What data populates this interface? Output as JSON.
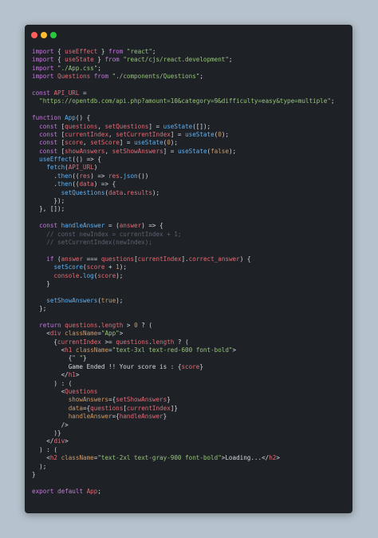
{
  "window": {
    "buttons": [
      "close",
      "minimize",
      "maximize"
    ]
  },
  "code": {
    "lines": [
      [
        [
          "kw",
          "import"
        ],
        [
          "pl",
          " { "
        ],
        [
          "var",
          "useEffect"
        ],
        [
          "pl",
          " } "
        ],
        [
          "kw",
          "from"
        ],
        [
          "pl",
          " "
        ],
        [
          "str",
          "\"react\""
        ],
        [
          "pl",
          ";"
        ]
      ],
      [
        [
          "kw",
          "import"
        ],
        [
          "pl",
          " { "
        ],
        [
          "var",
          "useState"
        ],
        [
          "pl",
          " } "
        ],
        [
          "kw",
          "from"
        ],
        [
          "pl",
          " "
        ],
        [
          "str",
          "\"react/cjs/react.development\""
        ],
        [
          "pl",
          ";"
        ]
      ],
      [
        [
          "kw",
          "import"
        ],
        [
          "pl",
          " "
        ],
        [
          "str",
          "\"./App.css\""
        ],
        [
          "pl",
          ";"
        ]
      ],
      [
        [
          "kw",
          "import"
        ],
        [
          "pl",
          " "
        ],
        [
          "var",
          "Questions"
        ],
        [
          "pl",
          " "
        ],
        [
          "kw",
          "from"
        ],
        [
          "pl",
          " "
        ],
        [
          "str",
          "\"./components/Questions\""
        ],
        [
          "pl",
          ";"
        ]
      ],
      [],
      [
        [
          "kw",
          "const"
        ],
        [
          "pl",
          " "
        ],
        [
          "var",
          "API_URL"
        ],
        [
          "pl",
          " ="
        ]
      ],
      [
        [
          "pl",
          "  "
        ],
        [
          "str",
          "\"https://opentdb.com/api.php?amount=10&category=9&difficulty=easy&type=multiple\""
        ],
        [
          "pl",
          ";"
        ]
      ],
      [],
      [
        [
          "kw",
          "function"
        ],
        [
          "pl",
          " "
        ],
        [
          "fn",
          "App"
        ],
        [
          "pl",
          "() {"
        ]
      ],
      [
        [
          "pl",
          "  "
        ],
        [
          "kw",
          "const"
        ],
        [
          "pl",
          " ["
        ],
        [
          "var",
          "questions"
        ],
        [
          "pl",
          ", "
        ],
        [
          "var",
          "setQuestions"
        ],
        [
          "pl",
          "] = "
        ],
        [
          "fn",
          "useState"
        ],
        [
          "pl",
          "([]);"
        ]
      ],
      [
        [
          "pl",
          "  "
        ],
        [
          "kw",
          "const"
        ],
        [
          "pl",
          " ["
        ],
        [
          "var",
          "currentIndex"
        ],
        [
          "pl",
          ", "
        ],
        [
          "var",
          "setCurrentIndex"
        ],
        [
          "pl",
          "] = "
        ],
        [
          "fn",
          "useState"
        ],
        [
          "pl",
          "("
        ],
        [
          "num",
          "0"
        ],
        [
          "pl",
          ");"
        ]
      ],
      [
        [
          "pl",
          "  "
        ],
        [
          "kw",
          "const"
        ],
        [
          "pl",
          " ["
        ],
        [
          "var",
          "score"
        ],
        [
          "pl",
          ", "
        ],
        [
          "var",
          "setScore"
        ],
        [
          "pl",
          "] = "
        ],
        [
          "fn",
          "useState"
        ],
        [
          "pl",
          "("
        ],
        [
          "num",
          "0"
        ],
        [
          "pl",
          ");"
        ]
      ],
      [
        [
          "pl",
          "  "
        ],
        [
          "kw",
          "const"
        ],
        [
          "pl",
          " ["
        ],
        [
          "var",
          "showAnswers"
        ],
        [
          "pl",
          ", "
        ],
        [
          "var",
          "setShowAnswers"
        ],
        [
          "pl",
          "] = "
        ],
        [
          "fn",
          "useState"
        ],
        [
          "pl",
          "("
        ],
        [
          "num",
          "false"
        ],
        [
          "pl",
          ");"
        ]
      ],
      [
        [
          "pl",
          "  "
        ],
        [
          "fn",
          "useEffect"
        ],
        [
          "pl",
          "(() => {"
        ]
      ],
      [
        [
          "pl",
          "    "
        ],
        [
          "fn",
          "fetch"
        ],
        [
          "pl",
          "("
        ],
        [
          "var",
          "API_URL"
        ],
        [
          "pl",
          ")"
        ]
      ],
      [
        [
          "pl",
          "      ."
        ],
        [
          "fn",
          "then"
        ],
        [
          "pl",
          "(("
        ],
        [
          "var",
          "res"
        ],
        [
          "pl",
          ") => "
        ],
        [
          "var",
          "res"
        ],
        [
          "pl",
          "."
        ],
        [
          "fn",
          "json"
        ],
        [
          "pl",
          "())"
        ]
      ],
      [
        [
          "pl",
          "      ."
        ],
        [
          "fn",
          "then"
        ],
        [
          "pl",
          "(("
        ],
        [
          "var",
          "data"
        ],
        [
          "pl",
          ") => {"
        ]
      ],
      [
        [
          "pl",
          "        "
        ],
        [
          "fn",
          "setQuestions"
        ],
        [
          "pl",
          "("
        ],
        [
          "var",
          "data"
        ],
        [
          "pl",
          "."
        ],
        [
          "var",
          "results"
        ],
        [
          "pl",
          ");"
        ]
      ],
      [
        [
          "pl",
          "      });"
        ]
      ],
      [
        [
          "pl",
          "  }, []);"
        ]
      ],
      [],
      [
        [
          "pl",
          "  "
        ],
        [
          "kw",
          "const"
        ],
        [
          "pl",
          " "
        ],
        [
          "fn",
          "handleAnswer"
        ],
        [
          "pl",
          " = ("
        ],
        [
          "var",
          "answer"
        ],
        [
          "pl",
          ") => {"
        ]
      ],
      [
        [
          "cm",
          "    // const newIndex = currentIndex + 1;"
        ]
      ],
      [
        [
          "cm",
          "    // setCurrentIndex(newIndex);"
        ]
      ],
      [],
      [
        [
          "pl",
          "    "
        ],
        [
          "kw",
          "if"
        ],
        [
          "pl",
          " ("
        ],
        [
          "var",
          "answer"
        ],
        [
          "pl",
          " === "
        ],
        [
          "var",
          "questions"
        ],
        [
          "pl",
          "["
        ],
        [
          "var",
          "currentIndex"
        ],
        [
          "pl",
          "]."
        ],
        [
          "var",
          "correct_answer"
        ],
        [
          "pl",
          ") {"
        ]
      ],
      [
        [
          "pl",
          "      "
        ],
        [
          "fn",
          "setScore"
        ],
        [
          "pl",
          "("
        ],
        [
          "var",
          "score"
        ],
        [
          "pl",
          " + "
        ],
        [
          "num",
          "1"
        ],
        [
          "pl",
          ");"
        ]
      ],
      [
        [
          "pl",
          "      "
        ],
        [
          "var",
          "console"
        ],
        [
          "pl",
          "."
        ],
        [
          "fn",
          "log"
        ],
        [
          "pl",
          "("
        ],
        [
          "var",
          "score"
        ],
        [
          "pl",
          ");"
        ]
      ],
      [
        [
          "pl",
          "    }"
        ]
      ],
      [],
      [
        [
          "pl",
          "    "
        ],
        [
          "fn",
          "setShowAnswers"
        ],
        [
          "pl",
          "("
        ],
        [
          "num",
          "true"
        ],
        [
          "pl",
          ");"
        ]
      ],
      [
        [
          "pl",
          "  };"
        ]
      ],
      [],
      [
        [
          "pl",
          "  "
        ],
        [
          "kw",
          "return"
        ],
        [
          "pl",
          " "
        ],
        [
          "var",
          "questions"
        ],
        [
          "pl",
          "."
        ],
        [
          "var",
          "length"
        ],
        [
          "pl",
          " > "
        ],
        [
          "num",
          "0"
        ],
        [
          "pl",
          " ? ("
        ]
      ],
      [
        [
          "pl",
          "    <"
        ],
        [
          "tag",
          "div"
        ],
        [
          "pl",
          " "
        ],
        [
          "attr",
          "className"
        ],
        [
          "pl",
          "="
        ],
        [
          "str",
          "\"App\""
        ],
        [
          "pl",
          ">"
        ]
      ],
      [
        [
          "pl",
          "      {"
        ],
        [
          "var",
          "currentIndex"
        ],
        [
          "pl",
          " >= "
        ],
        [
          "var",
          "questions"
        ],
        [
          "pl",
          "."
        ],
        [
          "var",
          "length"
        ],
        [
          "pl",
          " ? ("
        ]
      ],
      [
        [
          "pl",
          "        <"
        ],
        [
          "tag",
          "h1"
        ],
        [
          "pl",
          " "
        ],
        [
          "attr",
          "className"
        ],
        [
          "pl",
          "="
        ],
        [
          "str",
          "\"text-3xl text-red-600 font-bold\""
        ],
        [
          "pl",
          ">"
        ]
      ],
      [
        [
          "pl",
          "          {"
        ],
        [
          "str",
          "\" \""
        ],
        [
          "pl",
          "}"
        ]
      ],
      [
        [
          "pl",
          "          Game Ended !! Your score is : {"
        ],
        [
          "var",
          "score"
        ],
        [
          "pl",
          "}"
        ]
      ],
      [
        [
          "pl",
          "        </"
        ],
        [
          "tag",
          "h1"
        ],
        [
          "pl",
          ">"
        ]
      ],
      [
        [
          "pl",
          "      ) : ("
        ]
      ],
      [
        [
          "pl",
          "        <"
        ],
        [
          "tag",
          "Questions"
        ]
      ],
      [
        [
          "pl",
          "          "
        ],
        [
          "attr",
          "showAnswers"
        ],
        [
          "pl",
          "={"
        ],
        [
          "var",
          "setShowAnswers"
        ],
        [
          "pl",
          "}"
        ]
      ],
      [
        [
          "pl",
          "          "
        ],
        [
          "attr",
          "data"
        ],
        [
          "pl",
          "={"
        ],
        [
          "var",
          "questions"
        ],
        [
          "pl",
          "["
        ],
        [
          "var",
          "currentIndex"
        ],
        [
          "pl",
          "]}"
        ]
      ],
      [
        [
          "pl",
          "          "
        ],
        [
          "attr",
          "handleAnswer"
        ],
        [
          "pl",
          "={"
        ],
        [
          "var",
          "handleAnswer"
        ],
        [
          "pl",
          "}"
        ]
      ],
      [
        [
          "pl",
          "        />"
        ]
      ],
      [
        [
          "pl",
          "      )}"
        ]
      ],
      [
        [
          "pl",
          "    </"
        ],
        [
          "tag",
          "div"
        ],
        [
          "pl",
          ">"
        ]
      ],
      [
        [
          "pl",
          "  ) : ("
        ]
      ],
      [
        [
          "pl",
          "    <"
        ],
        [
          "tag",
          "h2"
        ],
        [
          "pl",
          " "
        ],
        [
          "attr",
          "className"
        ],
        [
          "pl",
          "="
        ],
        [
          "str",
          "\"text-2xl text-gray-900 font-bold\""
        ],
        [
          "pl",
          ">Loading...</"
        ],
        [
          "tag",
          "h2"
        ],
        [
          "pl",
          ">"
        ]
      ],
      [
        [
          "pl",
          "  );"
        ]
      ],
      [
        [
          "pl",
          "}"
        ]
      ],
      [],
      [
        [
          "kw",
          "export"
        ],
        [
          "pl",
          " "
        ],
        [
          "kw",
          "default"
        ],
        [
          "pl",
          " "
        ],
        [
          "var",
          "App"
        ],
        [
          "pl",
          ";"
        ]
      ]
    ]
  }
}
